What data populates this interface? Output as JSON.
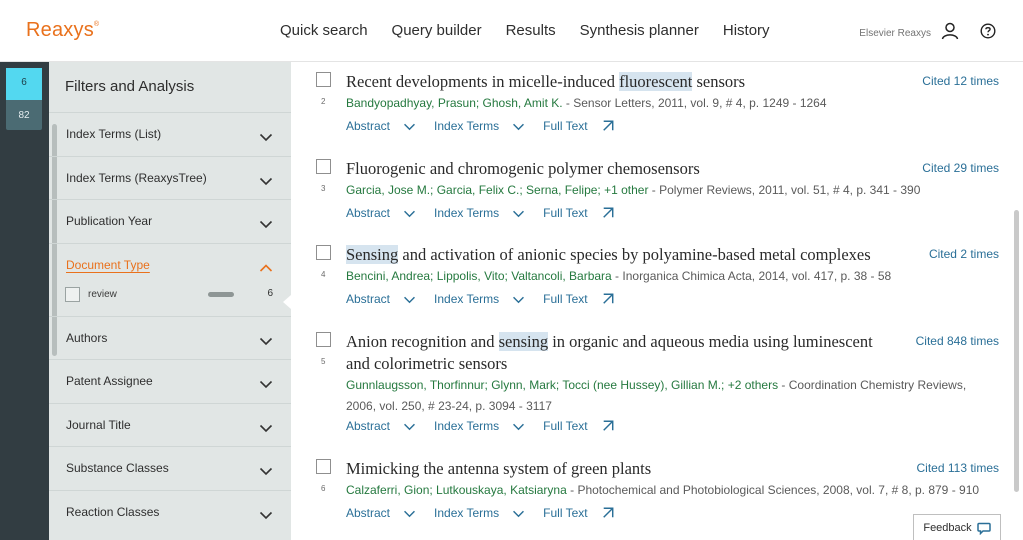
{
  "header": {
    "logo": "Reaxys",
    "logo_mark": "®",
    "nav": [
      "Quick search",
      "Query builder",
      "Results",
      "Synthesis planner",
      "History"
    ],
    "organization": "Elsevier Reaxys",
    "user_icon": "user-icon",
    "help_icon": "help-icon"
  },
  "rail": {
    "tabs": [
      {
        "label": "6",
        "active": true
      },
      {
        "label": "82",
        "active": false
      }
    ]
  },
  "filters": {
    "title": "Filters and Analysis",
    "items": [
      {
        "label": "Index Terms (List)",
        "expanded": false
      },
      {
        "label": "Index Terms (ReaxysTree)",
        "expanded": false
      },
      {
        "label": "Publication Year",
        "expanded": false
      },
      {
        "label": "Document Type",
        "expanded": true,
        "facets": [
          {
            "label": "review",
            "count": "6",
            "checked": false
          }
        ]
      },
      {
        "label": "Authors",
        "expanded": false
      },
      {
        "label": "Patent Assignee",
        "expanded": false
      },
      {
        "label": "Journal Title",
        "expanded": false
      },
      {
        "label": "Substance Classes",
        "expanded": false
      },
      {
        "label": "Reaction Classes",
        "expanded": false
      }
    ]
  },
  "results": {
    "link_labels": {
      "abstract": "Abstract",
      "index_terms": "Index Terms",
      "full_text": "Full Text"
    },
    "items": [
      {
        "number": "2",
        "title_parts": [
          "Recent developments in micelle-induced ",
          "fluorescent",
          " sensors"
        ],
        "cited": "Cited 12 times",
        "authors": "Bandyopadhyay, Prasun; Ghosh, Amit K.",
        "source": " - Sensor Letters, 2011, vol. 9, # 4, p. 1249 - 1264"
      },
      {
        "number": "3",
        "title_parts": [
          "Fluorogenic and chromogenic polymer chemosensors",
          "",
          ""
        ],
        "cited": "Cited 29 times",
        "authors": "Garcia, Jose M.; Garcia, Felix C.; Serna, Felipe; +1 other",
        "source": " - Polymer Reviews, 2011, vol. 51, # 4, p. 341 - 390"
      },
      {
        "number": "4",
        "title_parts": [
          "",
          "Sensing",
          " and activation of anionic species by polyamine-based metal complexes"
        ],
        "cited": "Cited 2 times",
        "authors": "Bencini, Andrea; Lippolis, Vito; Valtancoli, Barbara",
        "source": " - Inorganica Chimica Acta, 2014, vol. 417, p. 38 - 58"
      },
      {
        "number": "5",
        "title_parts": [
          "Anion recognition and ",
          "sensing",
          " in organic and aqueous media using luminescent and colorimetric sensors"
        ],
        "cited": "Cited 848 times",
        "authors": "Gunnlaugsson, Thorfinnur; Glynn, Mark; Tocci (nee Hussey), Gillian M.; +2 others",
        "source": " - Coordination Chemistry Reviews, 2006, vol. 250, # 23-24, p. 3094 - 3117"
      },
      {
        "number": "6",
        "title_parts": [
          "Mimicking the antenna system of green plants",
          "",
          ""
        ],
        "cited": "Cited 113 times",
        "authors": "Calzaferri, Gion; Lutkouskaya, Katsiaryna",
        "source": " - Photochemical and Photobiological Sciences, 2008, vol. 7, # 8, p. 879 - 910"
      }
    ]
  },
  "feedback": {
    "label": "Feedback"
  },
  "colors": {
    "brand_orange": "#e9711c",
    "link_blue": "#2a6f97",
    "author_green": "#25793f",
    "rail_dark": "#323d42",
    "rail_active": "#53d8f0",
    "filters_bg": "#e1e6e5",
    "highlight": "#d6e4ef"
  }
}
